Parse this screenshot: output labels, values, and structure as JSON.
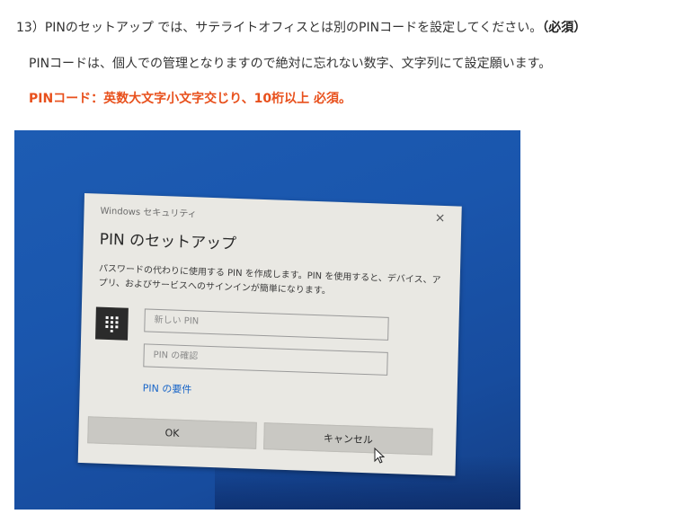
{
  "instructions": {
    "line1_prefix": "13）PINのセットアップ では、サテライトオフィスとは別のPINコードを設定してください。",
    "line1_required": "（必須）",
    "line2": "PINコードは、個人での管理となりますので絶対に忘れない数字、文字列にて設定願います。",
    "line3": "PINコード：英数大文字小文字交じり、10桁以上 必須。"
  },
  "dialog": {
    "header": "Windows セキュリティ",
    "close": "×",
    "title": "PIN のセットアップ",
    "description": "パスワードの代わりに使用する PIN を作成します。PIN を使用すると、デバイス、アプリ、およびサービスへのサインインが簡単になります。",
    "icon": "keypad-icon",
    "new_pin_placeholder": "新しい PIN",
    "confirm_pin_placeholder": "PIN の確認",
    "requirements_link": "PIN の要件",
    "ok_label": "OK",
    "cancel_label": "キャンセル"
  },
  "colors": {
    "accent": "#e8501c",
    "link": "#1a66c8",
    "desktop": "#1a56ad"
  }
}
